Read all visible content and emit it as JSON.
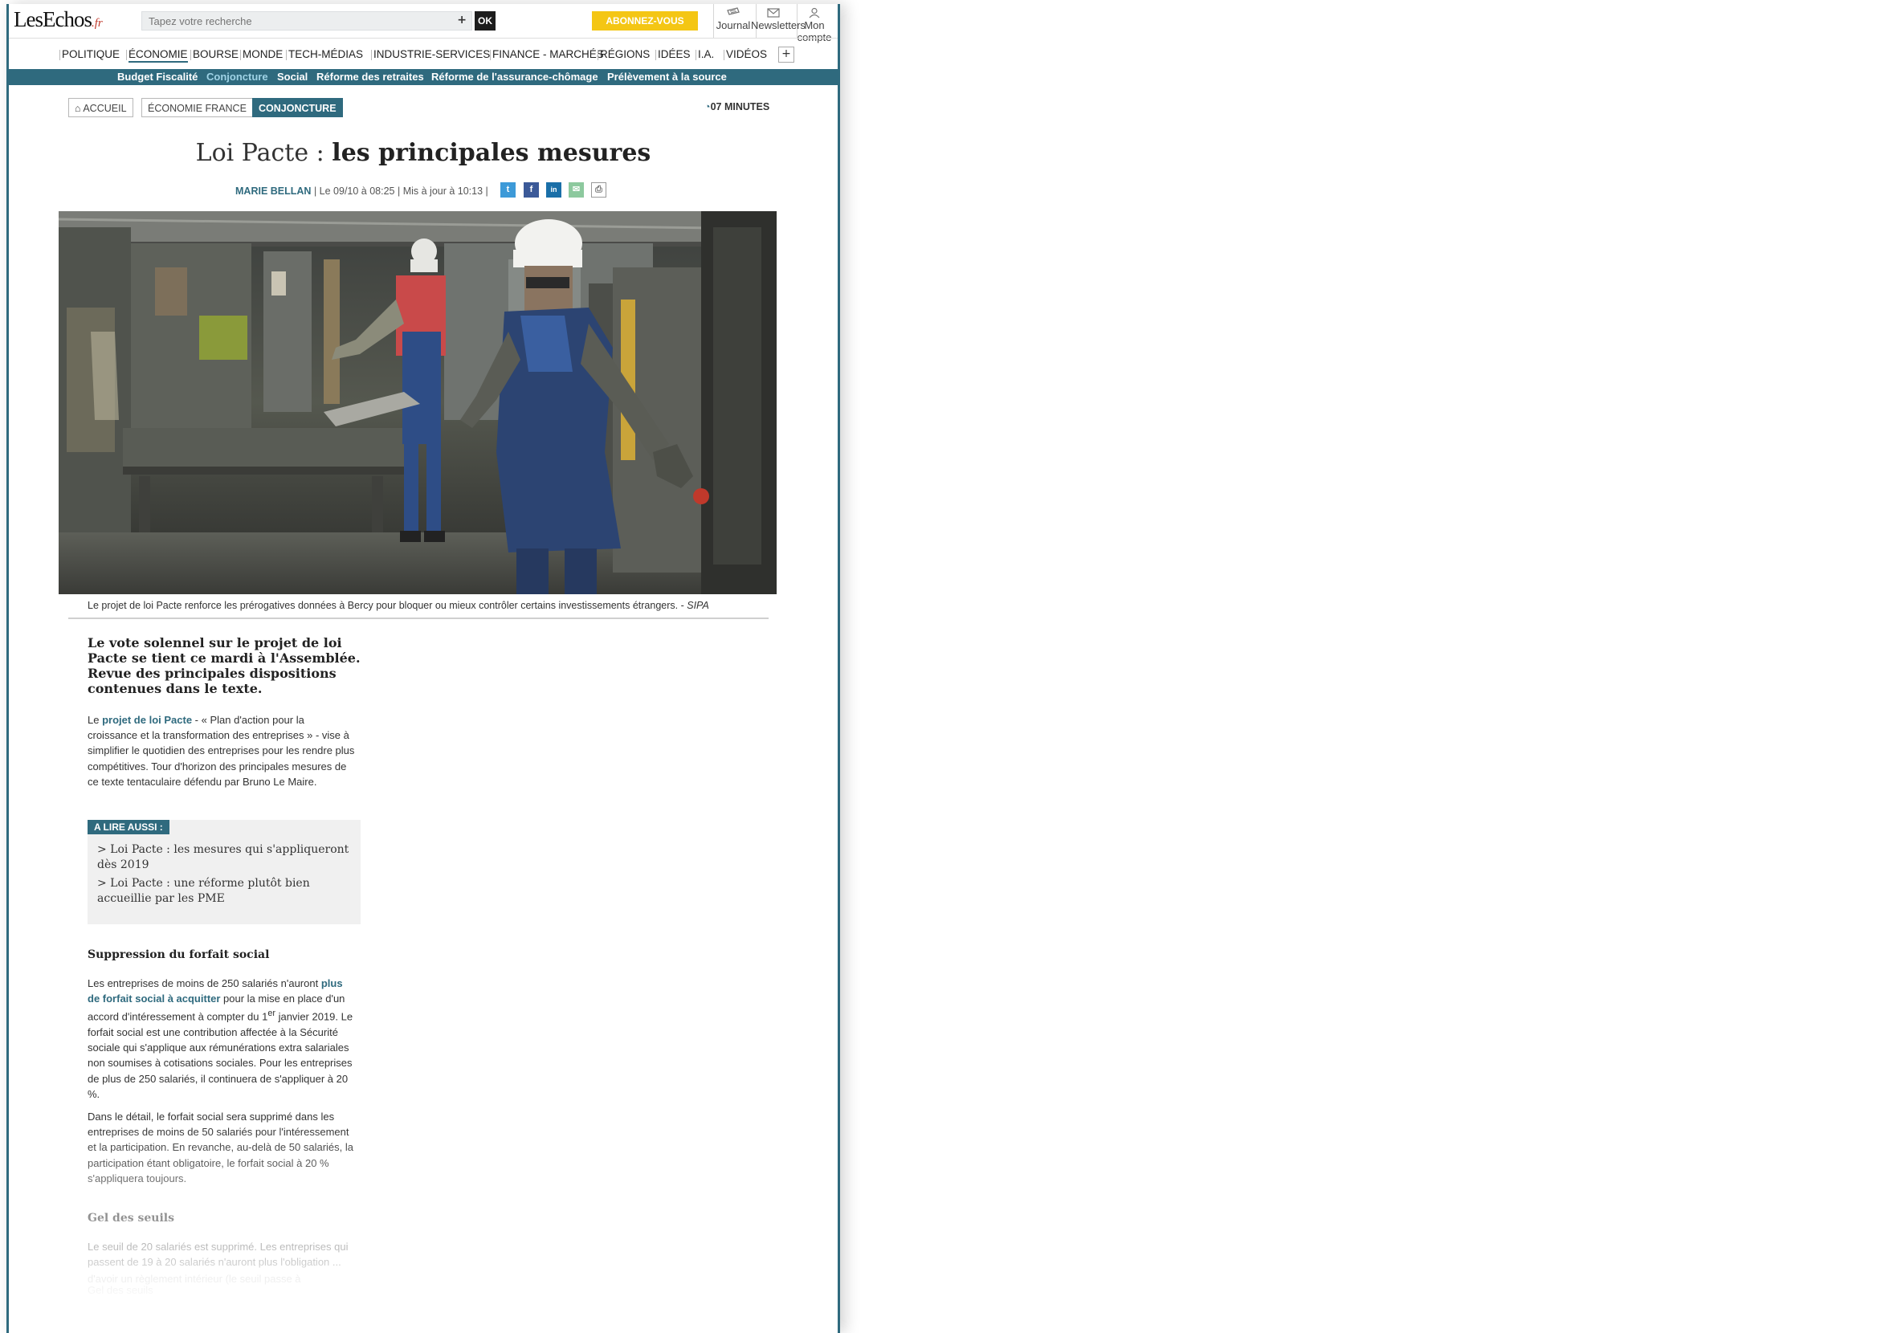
{
  "header": {
    "logo": "LesEchos",
    "logo_suffix": ".fr",
    "search_placeholder": "Tapez votre recherche",
    "search_plus": "+",
    "ok_label": "OK",
    "subscribe_label": "ABONNEZ-VOUS",
    "tools": [
      {
        "label": "Journal",
        "icon": "newspaper-icon"
      },
      {
        "label": "Newsletters",
        "icon": "envelope-icon"
      },
      {
        "label": "Mon compte",
        "icon": "user-icon"
      }
    ]
  },
  "nav": {
    "items": [
      "POLITIQUE",
      "ÉCONOMIE",
      "BOURSE",
      "MONDE",
      "TECH-MÉDIAS",
      "INDUSTRIE-SERVICES",
      "FINANCE - MARCHÉS",
      "RÉGIONS",
      "IDÉES",
      "I.A.",
      "VIDÉOS"
    ],
    "active": "ÉCONOMIE",
    "more_label": "+"
  },
  "subnav": {
    "items": [
      "Budget Fiscalité",
      "Conjoncture",
      "Social",
      "Réforme des retraites",
      "Réforme de l'assurance-chômage",
      "Prélèvement à la source"
    ],
    "active": "Conjoncture"
  },
  "breadcrumb": {
    "home": "ACCUEIL",
    "section": "ÉCONOMIE FRANCE",
    "current": "CONJONCTURE",
    "read_time": "07 MINUTES"
  },
  "article": {
    "title_light": "Loi Pacte : ",
    "title_bold": "les principales mesures",
    "author": "MARIE BELLAN",
    "published": "| Le 09/10 à 08:25 |",
    "updated": "Mis à jour à 10:13",
    "updated_sep": "|",
    "share": [
      {
        "icon": "twitter-icon",
        "glyph": "t",
        "color": "#3d9ad8"
      },
      {
        "icon": "facebook-icon",
        "glyph": "f",
        "color": "#3b5998"
      },
      {
        "icon": "linkedin-icon",
        "glyph": "in",
        "color": "#1a6fa8"
      },
      {
        "icon": "email-icon",
        "glyph": "✉",
        "color": "#8dc99e"
      },
      {
        "icon": "print-icon",
        "glyph": "⎙",
        "color": "#ffffff"
      }
    ],
    "caption_text": "Le projet de loi Pacte renforce les prérogatives données à Bercy pour bloquer ou mieux contrôler certains investissements étrangers. - ",
    "caption_credit": "SIPA",
    "lead": "Le vote solennel sur le projet de loi Pacte se tient ce mardi à l'Assemblée. Revue des principales dispositions contenues dans le texte.",
    "para1_pre": "Le ",
    "para1_link": " projet de loi Pacte",
    "para1_post": " - « Plan d'action pour la croissance et la transformation des entreprises » - vise à simplifier le quotidien des entreprises pour les rendre plus compétitives. Tour d'horizon des principales mesures de ce texte tentaculaire défendu par Bruno Le Maire.",
    "aside_tag": "A LIRE AUSSI :",
    "aside_links": [
      "> Loi Pacte : les mesures qui s'appliqueront dès 2019",
      "> Loi Pacte : une réforme plutôt bien accueillie par les PME"
    ],
    "h_forfait": "Suppression du forfait social",
    "para2_pre": "Les entreprises de moins de 250 salariés n'auront ",
    "para2_link": " plus de forfait social à acquitter",
    "para2_mid": " pour la mise en place d'un accord d'intéressement à compter du 1",
    "para2_sup": "er",
    "para2_post": " janvier 2019. Le forfait social est une contribution affectée à la Sécurité sociale qui s'applique aux rémunérations extra salariales non soumises à cotisations sociales. Pour les entreprises de plus de 250 salariés, il continuera de s'appliquer à 20 %.",
    "para3": "Dans le détail, le forfait social sera supprimé dans les entreprises de moins de 50 salariés pour l'intéressement et la participation. En revanche, au-delà de 50 salariés, la participation étant obligatoire, le forfait social à 20 % s'appliquera toujours.",
    "h_seuils": "Gel des seuils",
    "para4": "Le seuil de 20 salariés est supprimé. Les entreprises qui passent de 19 à 20 salariés n'auront plus l'obligation ...",
    "ghost_lines": [
      "d'avoir un règlement intérieur (le seuil passe à",
      "Gel des seuils",
      "Le seuil de 20 salariés est supprimé. Les entreprises qui"
    ]
  },
  "colors": {
    "brand": "#2f6a7e",
    "subscribe": "#f4c614",
    "ok_bg": "#1d1d1d"
  }
}
